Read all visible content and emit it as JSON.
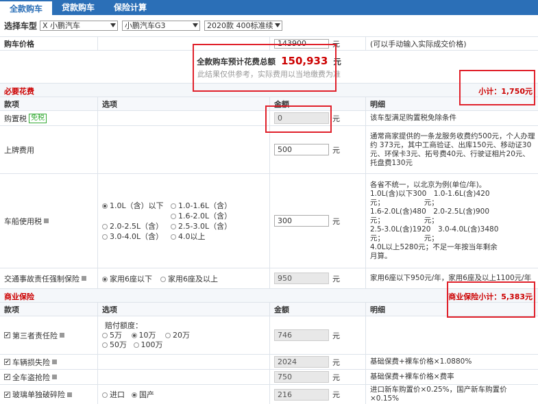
{
  "tabs": [
    {
      "label": "全款购车"
    },
    {
      "label": "贷款购车"
    },
    {
      "label": "保险计算"
    }
  ],
  "selector": {
    "label": "选择车型",
    "brand": "X 小鹏汽车",
    "series": "小鹏汽车G3",
    "model": "2020款 400标准续"
  },
  "price": {
    "label": "购车价格",
    "value": "143900",
    "unit": "元",
    "note": "(可以手动输入实际成交价格)"
  },
  "total": {
    "label": "全款购车预计花费总额",
    "value": "150,933",
    "unit": "元",
    "note": "此结果仅供参考，实际费用以当地缴费为准"
  },
  "required": {
    "title": "必要花费",
    "subtotal": "小计：1,750元"
  },
  "header": {
    "item": "款项",
    "option": "选项",
    "amount": "金额",
    "detail": "明细"
  },
  "purchase_tax": {
    "label": "购置税",
    "badge": "免税",
    "value": "0",
    "unit": "元",
    "detail": "该车型满足购置税免除条件"
  },
  "plate": {
    "label": "上牌费用",
    "value": "500",
    "unit": "元",
    "detail": "通常商家提供的一条龙服务收费约500元，个人办理约 373元，其中工商验证、出库150元、移动证30元、环保卡3元、拓号费40元、行驶证相片20元、托盘费130元"
  },
  "vessel_tax": {
    "label": "车船使用税",
    "options": [
      "1.0L（含）以下",
      "1.0-1.6L（含）",
      "1.6-2.0L（含）",
      "2.0-2.5L（含）",
      "2.5-3.0L（含）",
      "3.0-4.0L（含）",
      "4.0以上"
    ],
    "value": "300",
    "unit": "元",
    "detail": [
      "各省不统一，以北京为例(单位/年)。",
      "1.0L(含)以下300　1.0-1.6L(含)420",
      "元；　　　　　　元；",
      "1.6-2.0L(含)480　2.0-2.5L(含)900",
      "元；　　　　　　元；",
      "2.5-3.0L(含)1920　3.0-4.0L(含)3480",
      "元；　　　　　　元；",
      "4.0L以上5280元；不足一年按当年剩余",
      "月算。"
    ]
  },
  "compulsory": {
    "label": "交通事故责任强制保险",
    "opt1": "家用6座以下",
    "opt2": "家用6座及以上",
    "value": "950",
    "unit": "元",
    "detail": "家用6座以下950元/年，家用6座及以上1100元/年"
  },
  "commercial": {
    "title": "商业保险",
    "subtotal": "商业保险小计：5,383元"
  },
  "third_party": {
    "label": "第三者责任险",
    "amount_label": "赔付额度：",
    "opts": [
      "5万",
      "10万",
      "20万",
      "50万",
      "100万"
    ],
    "value": "746",
    "unit": "元"
  },
  "damage": {
    "label": "车辆损失险",
    "value": "2024",
    "unit": "元",
    "detail": "基础保费+裸车价格×1.0880%"
  },
  "theft": {
    "label": "全车盗抢险",
    "value": "750",
    "unit": "元",
    "detail": "基础保费+裸车价格×费率"
  },
  "glass": {
    "label": "玻璃单独破碎险",
    "opt1": "进口",
    "opt2": "国产",
    "value": "216",
    "unit": "元",
    "detail": "进口新车购置价×0.25%，国产新车购置价×0.15%"
  }
}
